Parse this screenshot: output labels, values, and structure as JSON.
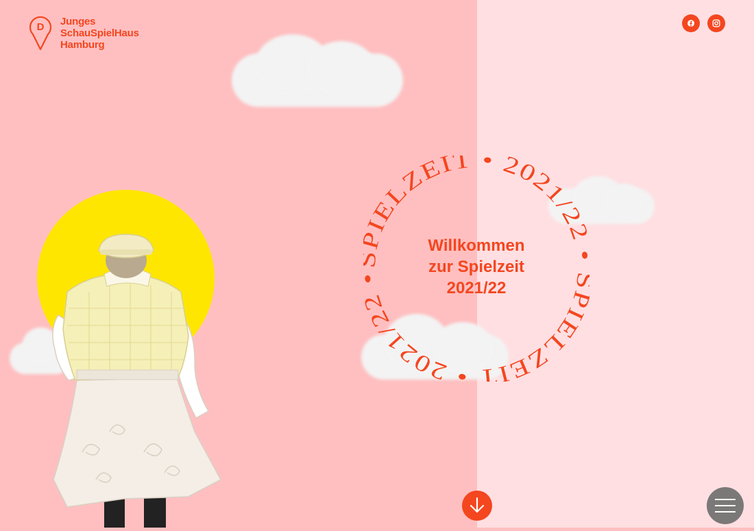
{
  "brand": {
    "logo_letter": "D",
    "name_lines": [
      "Junges",
      "SchauSpielHaus",
      "Hamburg"
    ],
    "accent_color": "#f4461f"
  },
  "social": {
    "facebook_icon": "facebook-icon",
    "instagram_icon": "instagram-icon"
  },
  "hero": {
    "ring_text": "SPIELZEIT • 2021/22 • SPIELZEIT • 2021/22 •",
    "welcome_lines": [
      "Willkommen",
      "zur Spielzeit",
      "2021/22"
    ],
    "sun_color": "#ffe600"
  },
  "controls": {
    "scroll_down_icon": "arrow-down-icon",
    "menu_icon": "hamburger-menu-icon"
  },
  "colors": {
    "left_bg": "#ffbfc0",
    "right_bg": "#ffdfe2"
  }
}
